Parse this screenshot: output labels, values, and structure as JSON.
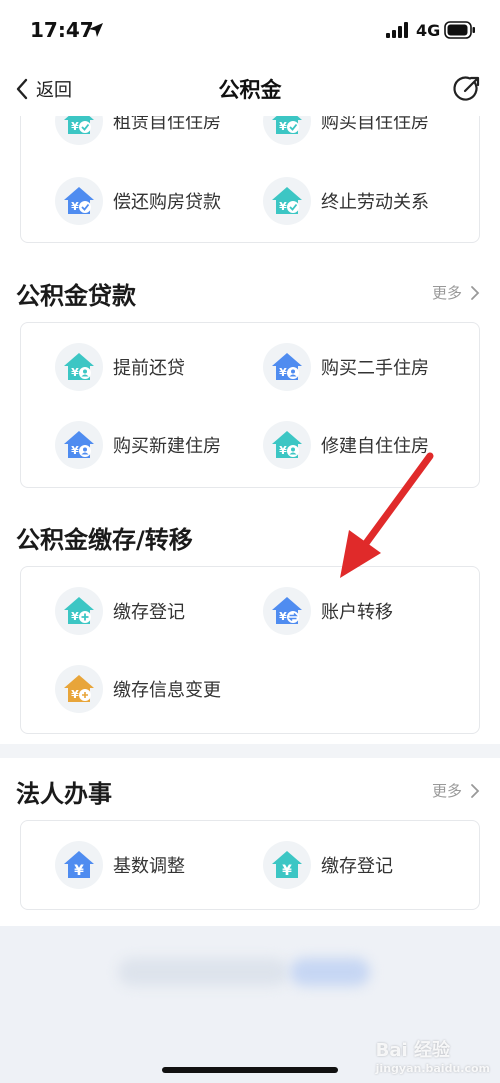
{
  "status": {
    "time": "17:47",
    "network": "4G"
  },
  "nav": {
    "back_label": "返回",
    "title": "公积金"
  },
  "sections": {
    "withdraw": {
      "items": [
        {
          "label": "租赁自住住房",
          "icon": "house-check-icon",
          "color": "teal"
        },
        {
          "label": "购买自住住房",
          "icon": "house-check-icon",
          "color": "teal"
        },
        {
          "label": "偿还购房贷款",
          "icon": "house-check-icon",
          "color": "blue"
        },
        {
          "label": "终止劳动关系",
          "icon": "house-check-icon",
          "color": "teal"
        }
      ]
    },
    "loan": {
      "title": "公积金贷款",
      "more": "更多",
      "items": [
        {
          "label": "提前还贷",
          "icon": "house-person-icon",
          "color": "teal"
        },
        {
          "label": "购买二手住房",
          "icon": "house-person-icon",
          "color": "blue"
        },
        {
          "label": "购买新建住房",
          "icon": "house-person-icon",
          "color": "blue"
        },
        {
          "label": "修建自住住房",
          "icon": "house-person-icon",
          "color": "teal"
        }
      ]
    },
    "deposit": {
      "title": "公积金缴存/转移",
      "items": [
        {
          "label": "缴存登记",
          "icon": "house-plus-icon",
          "color": "teal"
        },
        {
          "label": "账户转移",
          "icon": "house-transfer-icon",
          "color": "blue"
        },
        {
          "label": "缴存信息变更",
          "icon": "house-edit-icon",
          "color": "orange"
        }
      ]
    },
    "corporate": {
      "title": "法人办事",
      "more": "更多",
      "items": [
        {
          "label": "基数调整",
          "icon": "house-yuan-icon",
          "color": "blue"
        },
        {
          "label": "缴存登记",
          "icon": "house-yuan-icon",
          "color": "teal"
        }
      ]
    }
  },
  "watermark": {
    "brand": "Bai 经验",
    "url": "jingyan.baidu.com"
  },
  "colors": {
    "teal": "#3cc6c4",
    "blue": "#4f8cf0",
    "orange": "#e8a53a",
    "arrow": "#e02a2a"
  }
}
